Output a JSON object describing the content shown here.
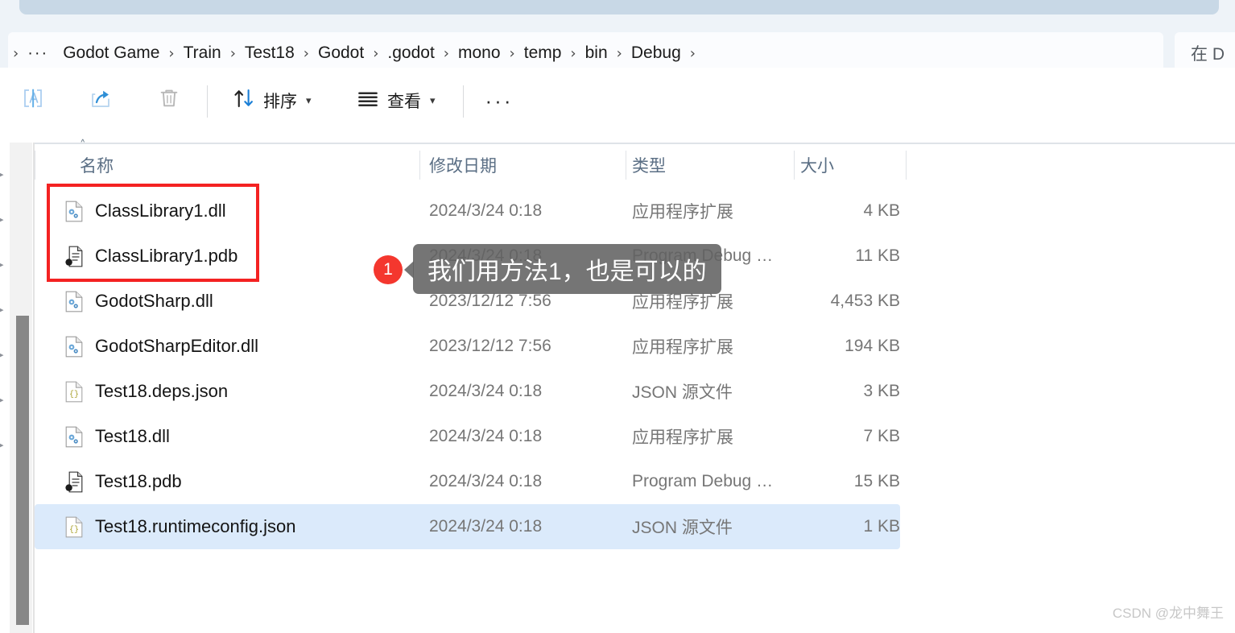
{
  "window": {
    "tab_strip_present": true
  },
  "address_bar": {
    "overflow_label": "···",
    "separator": "›",
    "crumbs": [
      "Godot Game",
      "Train",
      "Test18",
      "Godot",
      ".godot",
      "mono",
      "temp",
      "bin",
      "Debug"
    ],
    "leading_separator": "›"
  },
  "search": {
    "text": "在 D"
  },
  "toolbar": {
    "rename_icon": "rename-icon",
    "share_icon": "share-icon",
    "delete_icon": "trash-icon",
    "sort_label": "排序",
    "sort_icon": "sort-arrows-icon",
    "view_label": "查看",
    "view_icon": "view-list-icon",
    "more_label": "···"
  },
  "columns": {
    "name": "名称",
    "date_modified": "修改日期",
    "type": "类型",
    "size": "大小",
    "sort_indicator": "升序",
    "sort_caret": "˄"
  },
  "files": [
    {
      "name": "ClassLibrary1.dll",
      "date": "2024/3/24 0:18",
      "type": "应用程序扩展",
      "size": "4 KB",
      "icon": "dll-file-icon",
      "selected": false
    },
    {
      "name": "ClassLibrary1.pdb",
      "date": "2024/3/24 0:18",
      "type": "Program Debug …",
      "size": "11 KB",
      "icon": "pdb-file-icon",
      "selected": false
    },
    {
      "name": "GodotSharp.dll",
      "date": "2023/12/12 7:56",
      "type": "应用程序扩展",
      "size": "4,453 KB",
      "icon": "dll-file-icon",
      "selected": false
    },
    {
      "name": "GodotSharpEditor.dll",
      "date": "2023/12/12 7:56",
      "type": "应用程序扩展",
      "size": "194 KB",
      "icon": "dll-file-icon",
      "selected": false
    },
    {
      "name": "Test18.deps.json",
      "date": "2024/3/24 0:18",
      "type": "JSON 源文件",
      "size": "3 KB",
      "icon": "json-file-icon",
      "selected": false
    },
    {
      "name": "Test18.dll",
      "date": "2024/3/24 0:18",
      "type": "应用程序扩展",
      "size": "7 KB",
      "icon": "dll-file-icon",
      "selected": false
    },
    {
      "name": "Test18.pdb",
      "date": "2024/3/24 0:18",
      "type": "Program Debug …",
      "size": "15 KB",
      "icon": "pdb-file-icon",
      "selected": false
    },
    {
      "name": "Test18.runtimeconfig.json",
      "date": "2024/3/24 0:18",
      "type": "JSON 源文件",
      "size": "1 KB",
      "icon": "json-file-icon",
      "selected": true
    }
  ],
  "annotation": {
    "badge_number": "1",
    "callout_text": "我们用方法1，也是可以的",
    "highlight_color": "#f42222",
    "badge_color": "#f4372e"
  },
  "watermark": {
    "text": "CSDN @龙中舞王"
  },
  "colors": {
    "selection": "#dbeafb",
    "chrome": "#eef3f8",
    "header_text": "#5a6e84"
  }
}
